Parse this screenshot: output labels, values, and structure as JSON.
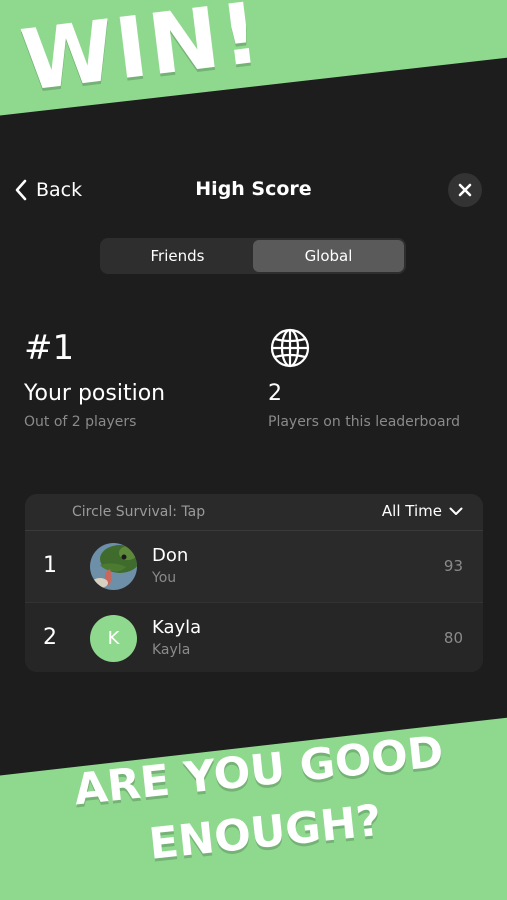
{
  "promo": {
    "headline_top": "WIN!",
    "headline_bottom_line1": "ARE YOU GOOD",
    "headline_bottom_line2": "ENOUGH?"
  },
  "nav": {
    "back_label": "Back",
    "title": "High Score"
  },
  "tabs": [
    {
      "label": "Friends",
      "active": false
    },
    {
      "label": "Global",
      "active": true
    }
  ],
  "stats": {
    "position_rank": "#1",
    "position_title": "Your position",
    "position_sub": "Out of 2 players",
    "player_count": "2",
    "player_count_sub": "Players on this leaderboard"
  },
  "leaderboard": {
    "game": "Circle Survival: Tap",
    "filter": "All Time",
    "rows": [
      {
        "rank": "1",
        "name": "Don",
        "sub": "You",
        "score": "93",
        "avatar": "lizard-avatar"
      },
      {
        "rank": "2",
        "name": "Kayla",
        "sub": "Kayla",
        "score": "80",
        "avatar_letter": "K"
      }
    ]
  },
  "colors": {
    "accent_green": "#8fd98f",
    "panel_dark": "#1d1d1d"
  }
}
